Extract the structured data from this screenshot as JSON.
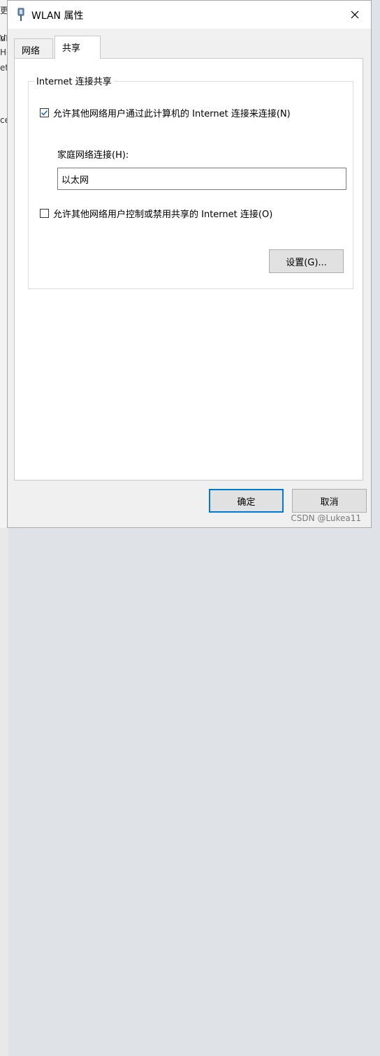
{
  "window": {
    "title": "WLAN 属性",
    "close_icon": "close-icon"
  },
  "background": {
    "left_fragments": [
      "更",
      "rl",
      "ce"
    ],
    "right_fragments": [
      "VL",
      "H-",
      "et"
    ]
  },
  "tabs": [
    {
      "label": "网络",
      "selected": false
    },
    {
      "label": "共享",
      "selected": true
    }
  ],
  "group": {
    "title": "Internet 连接共享",
    "allow_connect": {
      "label": "允许其他网络用户通过此计算机的 Internet 连接来连接(N)",
      "checked": true
    },
    "home_network": {
      "label": "家庭网络连接(H):",
      "value": "以太网"
    },
    "allow_control": {
      "label": "允许其他网络用户控制或禁用共享的 Internet 连接(O)",
      "checked": false
    },
    "settings_label": "设置(G)..."
  },
  "footer": {
    "ok_label": "确定",
    "cancel_label": "取消"
  },
  "watermark": "CSDN @Lukea11",
  "colors": {
    "accent": "#0078d7",
    "check": "#1a73c8"
  }
}
